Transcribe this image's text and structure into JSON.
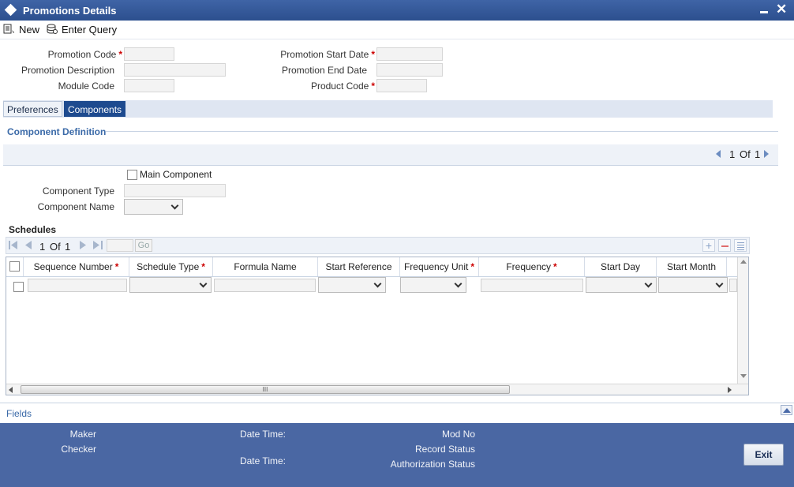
{
  "window": {
    "title": "Promotions Details"
  },
  "toolbar": {
    "new_label": "New",
    "enter_query_label": "Enter Query"
  },
  "header_fields": {
    "promotion_code": "Promotion Code",
    "promotion_description": "Promotion Description",
    "module_code": "Module Code",
    "promotion_start_date": "Promotion Start Date",
    "promotion_end_date": "Promotion End Date",
    "product_code": "Product Code",
    "required_marker": "*"
  },
  "tabs": [
    {
      "label": "Preferences",
      "active": false
    },
    {
      "label": "Components",
      "active": true
    }
  ],
  "component_definition": {
    "section_title": "Component Definition",
    "pager": {
      "current": "1",
      "of_label": "Of",
      "total": "1"
    },
    "main_component_label": "Main Component",
    "component_type_label": "Component Type",
    "component_name_label": "Component Name"
  },
  "schedules": {
    "title": "Schedules",
    "pager": {
      "current": "1",
      "of_label": "Of",
      "total": "1",
      "go_label": "Go"
    },
    "columns": [
      {
        "label": "Sequence Number",
        "required": true
      },
      {
        "label": "Schedule Type",
        "required": true
      },
      {
        "label": "Formula Name",
        "required": false
      },
      {
        "label": "Start Reference",
        "required": false
      },
      {
        "label": "Frequency Unit",
        "required": true
      },
      {
        "label": "Frequency",
        "required": true
      },
      {
        "label": "Start Day",
        "required": false
      },
      {
        "label": "Start Month",
        "required": false
      }
    ],
    "scroll_grip": "III"
  },
  "fields_label": "Fields",
  "footer": {
    "maker": "Maker",
    "checker": "Checker",
    "date_time_1": "Date Time:",
    "date_time_2": "Date Time:",
    "mod_no": "Mod No",
    "record_status": "Record Status",
    "authorization_status": "Authorization Status",
    "exit_label": "Exit"
  },
  "colors": {
    "title_bar": "#2c4f8e",
    "active_tab": "#1d4a8f",
    "footer": "#4a67a3",
    "section_title": "#3b6aa8",
    "required": "#cc0000"
  }
}
